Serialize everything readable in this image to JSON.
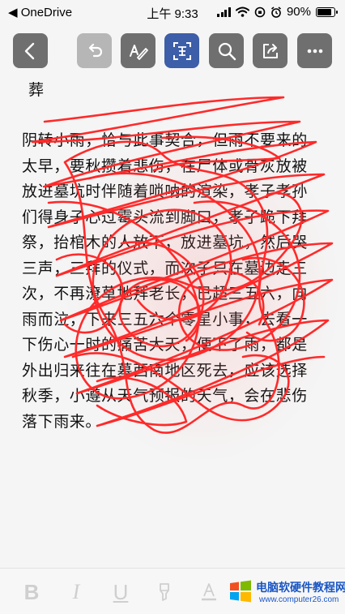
{
  "status_bar": {
    "back_app": "◀ OneDrive",
    "time": "上午 9:33",
    "battery": "90%",
    "battery_level": 0.9
  },
  "toolbar": {
    "buttons": [
      {
        "name": "back",
        "icon": "chevron-left-icon",
        "state": "normal"
      },
      {
        "name": "undo",
        "icon": "undo-icon",
        "state": "disabled"
      },
      {
        "name": "pen",
        "icon": "handwriting-pen-icon",
        "state": "normal"
      },
      {
        "name": "reading-view",
        "icon": "text-frame-icon",
        "state": "active"
      },
      {
        "name": "search",
        "icon": "search-icon",
        "state": "normal"
      },
      {
        "name": "share",
        "icon": "share-icon",
        "state": "normal"
      },
      {
        "name": "more",
        "icon": "more-icon",
        "state": "normal"
      }
    ]
  },
  "document": {
    "title": "葬",
    "body": "阴转小雨，恰与此事契合，但雨不要来的太早，要秋攒着悲伤，在尸体或骨灰放被放进墓坑时伴随着唢呐的渲染，孝子孝孙们得身子心过霉头流到脚口，孝子跪下拜祭，抬棺木的人放下，放进墓坑，然后哭三声，三拜的仪式，而次子只在墓边走三次，不再潦草地拜老长，已超三五六，向雨而泣，下来三五六个零星小事，去看一下伤心一时的痛苦大天，便下了雨，都是外出归来往在墓西南地区死去，应该选择秋季，小遵从天气预报的天气，会在悲伤落下雨来。"
  },
  "format_bar": {
    "bold_label": "B",
    "italic_label": "I",
    "underline_label": "U"
  },
  "watermark": {
    "title": "电脑软硬件教程网",
    "url": "www.computer26.com"
  },
  "colors": {
    "toolbar_button": "#6f6f6f",
    "toolbar_active": "#3d5ea8",
    "ink": "#ff2a2a",
    "watermark": "#1a56c4"
  }
}
